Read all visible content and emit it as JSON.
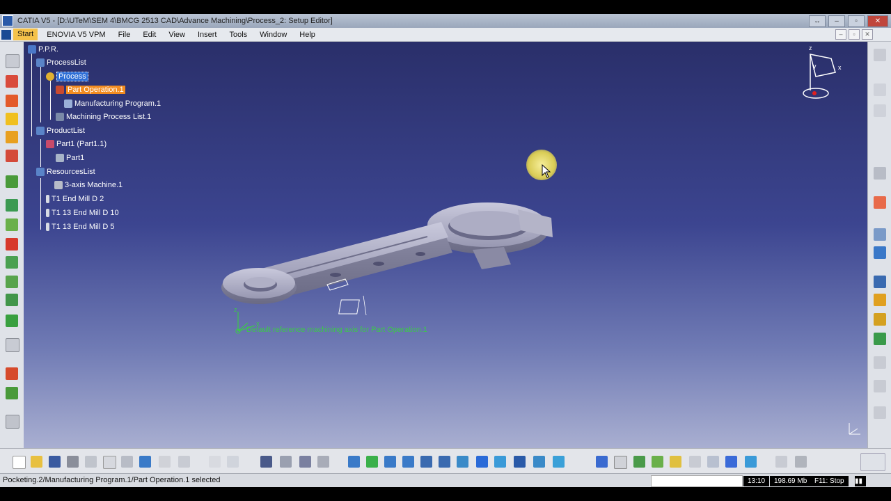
{
  "window": {
    "title": "CATIA V5 - [D:\\UTeM\\SEM 4\\BMCG 2513 CAD\\Advance Machining\\Process_2: Setup Editor]"
  },
  "menu": {
    "items": [
      "Start",
      "ENOVIA V5 VPM",
      "File",
      "Edit",
      "View",
      "Insert",
      "Tools",
      "Window",
      "Help"
    ]
  },
  "tree": {
    "root": "P.P.R.",
    "process_list": "ProcessList",
    "process": "Process",
    "part_operation": "Part Operation.1",
    "manufacturing_program": "Manufacturing Program.1",
    "machining_process_list": "Machining Process List.1",
    "product_list": "ProductList",
    "part1_instance": "Part1 (Part1.1)",
    "part1": "Part1",
    "resources_list": "ResourcesList",
    "machine": "3-axis Machine.1",
    "tool1": "T1 End Mill D 2",
    "tool2": "T1 13 End Mill D 10",
    "tool3": "T1 13 End Mill D 5"
  },
  "viewport": {
    "annotation": "Default reference machining axis for Part Operation.1",
    "compass_labels": {
      "z": "z",
      "x": "x",
      "y": "y"
    }
  },
  "status": {
    "message": "Pocketing.2/Manufacturing Program.1/Part Operation.1 selected",
    "time": "13:10",
    "memory": "198.69 Mb",
    "record": "F11: Stop"
  },
  "colors": {
    "selection": "#2f6fd6",
    "highlight": "#f28c20",
    "annotation": "#3cc84a"
  }
}
